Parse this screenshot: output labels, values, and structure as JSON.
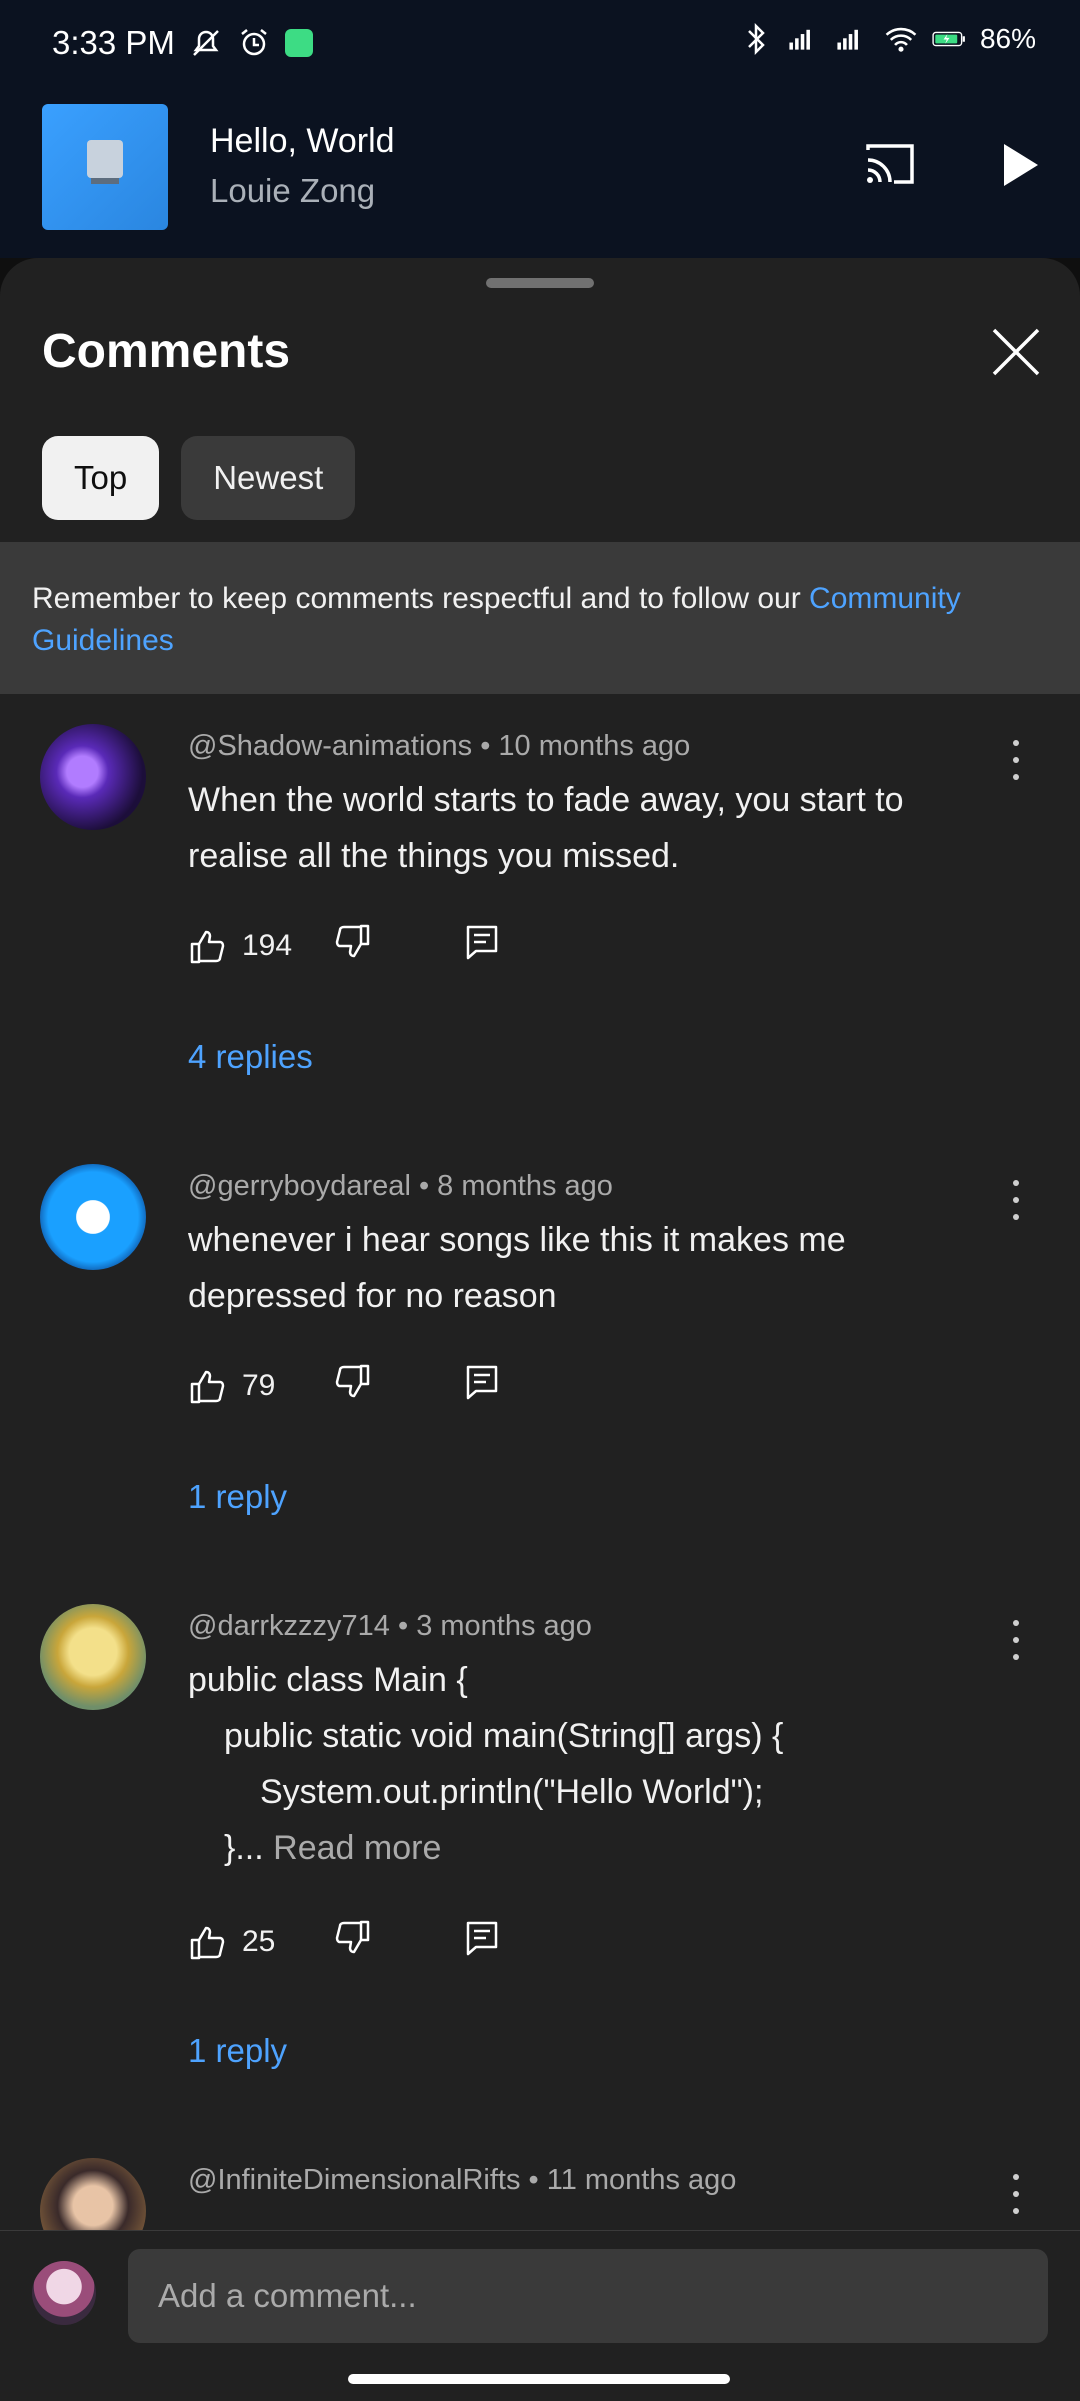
{
  "status_bar": {
    "time": "3:33 PM",
    "battery": "86%",
    "icons": [
      "mute-icon",
      "alarm-icon",
      "app-notification-icon",
      "bluetooth-icon",
      "signal-hd-icon",
      "signal-hd-icon",
      "wifi-icon",
      "battery-icon"
    ]
  },
  "mini_player": {
    "title": "Hello, World",
    "artist": "Louie Zong",
    "cast_icon": "cast-icon",
    "play_icon": "play-icon"
  },
  "sheet": {
    "title": "Comments",
    "close_icon": "close-icon",
    "tabs": [
      {
        "label": "Top",
        "active": true
      },
      {
        "label": "Newest",
        "active": false
      }
    ],
    "notice": {
      "text": "Remember to keep comments respectful and to follow our ",
      "link": "Community Guidelines"
    }
  },
  "comments": [
    {
      "author": "@Shadow-animations",
      "time": "10 months ago",
      "lines": [
        "When the world starts to fade away, you start to",
        "realise all the things you missed."
      ],
      "likes": "194",
      "replies": "4 replies"
    },
    {
      "author": "@gerryboydareal",
      "time": "8 months ago",
      "lines": [
        "whenever i hear songs like this it makes me",
        "depressed for no reason"
      ],
      "likes": "79",
      "replies": "1 reply"
    },
    {
      "author": "@darrkzzzy714",
      "time": "3 months ago",
      "lines": [
        "public class Main {",
        "public static void main(String[] args) {",
        "System.out.println(\"Hello World\");",
        "}..."
      ],
      "read_more": "Read more",
      "likes": "25",
      "replies": "1 reply"
    },
    {
      "author": "@InfiniteDimensionalRifts",
      "time": "11 months ago"
    }
  ],
  "separator": " • ",
  "composer": {
    "placeholder": "Add a comment..."
  },
  "colors": {
    "accent_link": "#4ea3ff",
    "sheet_bg": "#212121",
    "header_bg": "#0b1220"
  }
}
